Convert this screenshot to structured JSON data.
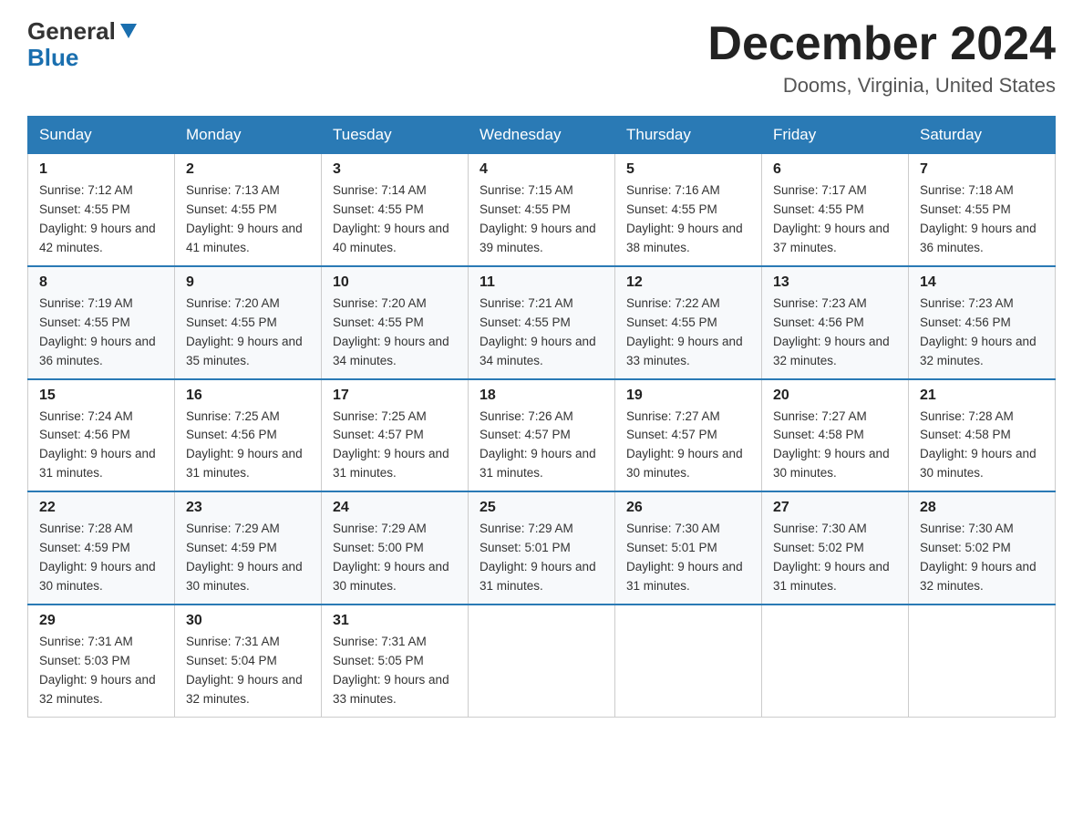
{
  "header": {
    "logo_general": "General",
    "logo_blue": "Blue",
    "month_title": "December 2024",
    "location": "Dooms, Virginia, United States"
  },
  "weekdays": [
    "Sunday",
    "Monday",
    "Tuesday",
    "Wednesday",
    "Thursday",
    "Friday",
    "Saturday"
  ],
  "weeks": [
    [
      {
        "day": "1",
        "sunrise": "7:12 AM",
        "sunset": "4:55 PM",
        "daylight": "9 hours and 42 minutes."
      },
      {
        "day": "2",
        "sunrise": "7:13 AM",
        "sunset": "4:55 PM",
        "daylight": "9 hours and 41 minutes."
      },
      {
        "day": "3",
        "sunrise": "7:14 AM",
        "sunset": "4:55 PM",
        "daylight": "9 hours and 40 minutes."
      },
      {
        "day": "4",
        "sunrise": "7:15 AM",
        "sunset": "4:55 PM",
        "daylight": "9 hours and 39 minutes."
      },
      {
        "day": "5",
        "sunrise": "7:16 AM",
        "sunset": "4:55 PM",
        "daylight": "9 hours and 38 minutes."
      },
      {
        "day": "6",
        "sunrise": "7:17 AM",
        "sunset": "4:55 PM",
        "daylight": "9 hours and 37 minutes."
      },
      {
        "day": "7",
        "sunrise": "7:18 AM",
        "sunset": "4:55 PM",
        "daylight": "9 hours and 36 minutes."
      }
    ],
    [
      {
        "day": "8",
        "sunrise": "7:19 AM",
        "sunset": "4:55 PM",
        "daylight": "9 hours and 36 minutes."
      },
      {
        "day": "9",
        "sunrise": "7:20 AM",
        "sunset": "4:55 PM",
        "daylight": "9 hours and 35 minutes."
      },
      {
        "day": "10",
        "sunrise": "7:20 AM",
        "sunset": "4:55 PM",
        "daylight": "9 hours and 34 minutes."
      },
      {
        "day": "11",
        "sunrise": "7:21 AM",
        "sunset": "4:55 PM",
        "daylight": "9 hours and 34 minutes."
      },
      {
        "day": "12",
        "sunrise": "7:22 AM",
        "sunset": "4:55 PM",
        "daylight": "9 hours and 33 minutes."
      },
      {
        "day": "13",
        "sunrise": "7:23 AM",
        "sunset": "4:56 PM",
        "daylight": "9 hours and 32 minutes."
      },
      {
        "day": "14",
        "sunrise": "7:23 AM",
        "sunset": "4:56 PM",
        "daylight": "9 hours and 32 minutes."
      }
    ],
    [
      {
        "day": "15",
        "sunrise": "7:24 AM",
        "sunset": "4:56 PM",
        "daylight": "9 hours and 31 minutes."
      },
      {
        "day": "16",
        "sunrise": "7:25 AM",
        "sunset": "4:56 PM",
        "daylight": "9 hours and 31 minutes."
      },
      {
        "day": "17",
        "sunrise": "7:25 AM",
        "sunset": "4:57 PM",
        "daylight": "9 hours and 31 minutes."
      },
      {
        "day": "18",
        "sunrise": "7:26 AM",
        "sunset": "4:57 PM",
        "daylight": "9 hours and 31 minutes."
      },
      {
        "day": "19",
        "sunrise": "7:27 AM",
        "sunset": "4:57 PM",
        "daylight": "9 hours and 30 minutes."
      },
      {
        "day": "20",
        "sunrise": "7:27 AM",
        "sunset": "4:58 PM",
        "daylight": "9 hours and 30 minutes."
      },
      {
        "day": "21",
        "sunrise": "7:28 AM",
        "sunset": "4:58 PM",
        "daylight": "9 hours and 30 minutes."
      }
    ],
    [
      {
        "day": "22",
        "sunrise": "7:28 AM",
        "sunset": "4:59 PM",
        "daylight": "9 hours and 30 minutes."
      },
      {
        "day": "23",
        "sunrise": "7:29 AM",
        "sunset": "4:59 PM",
        "daylight": "9 hours and 30 minutes."
      },
      {
        "day": "24",
        "sunrise": "7:29 AM",
        "sunset": "5:00 PM",
        "daylight": "9 hours and 30 minutes."
      },
      {
        "day": "25",
        "sunrise": "7:29 AM",
        "sunset": "5:01 PM",
        "daylight": "9 hours and 31 minutes."
      },
      {
        "day": "26",
        "sunrise": "7:30 AM",
        "sunset": "5:01 PM",
        "daylight": "9 hours and 31 minutes."
      },
      {
        "day": "27",
        "sunrise": "7:30 AM",
        "sunset": "5:02 PM",
        "daylight": "9 hours and 31 minutes."
      },
      {
        "day": "28",
        "sunrise": "7:30 AM",
        "sunset": "5:02 PM",
        "daylight": "9 hours and 32 minutes."
      }
    ],
    [
      {
        "day": "29",
        "sunrise": "7:31 AM",
        "sunset": "5:03 PM",
        "daylight": "9 hours and 32 minutes."
      },
      {
        "day": "30",
        "sunrise": "7:31 AM",
        "sunset": "5:04 PM",
        "daylight": "9 hours and 32 minutes."
      },
      {
        "day": "31",
        "sunrise": "7:31 AM",
        "sunset": "5:05 PM",
        "daylight": "9 hours and 33 minutes."
      },
      null,
      null,
      null,
      null
    ]
  ]
}
